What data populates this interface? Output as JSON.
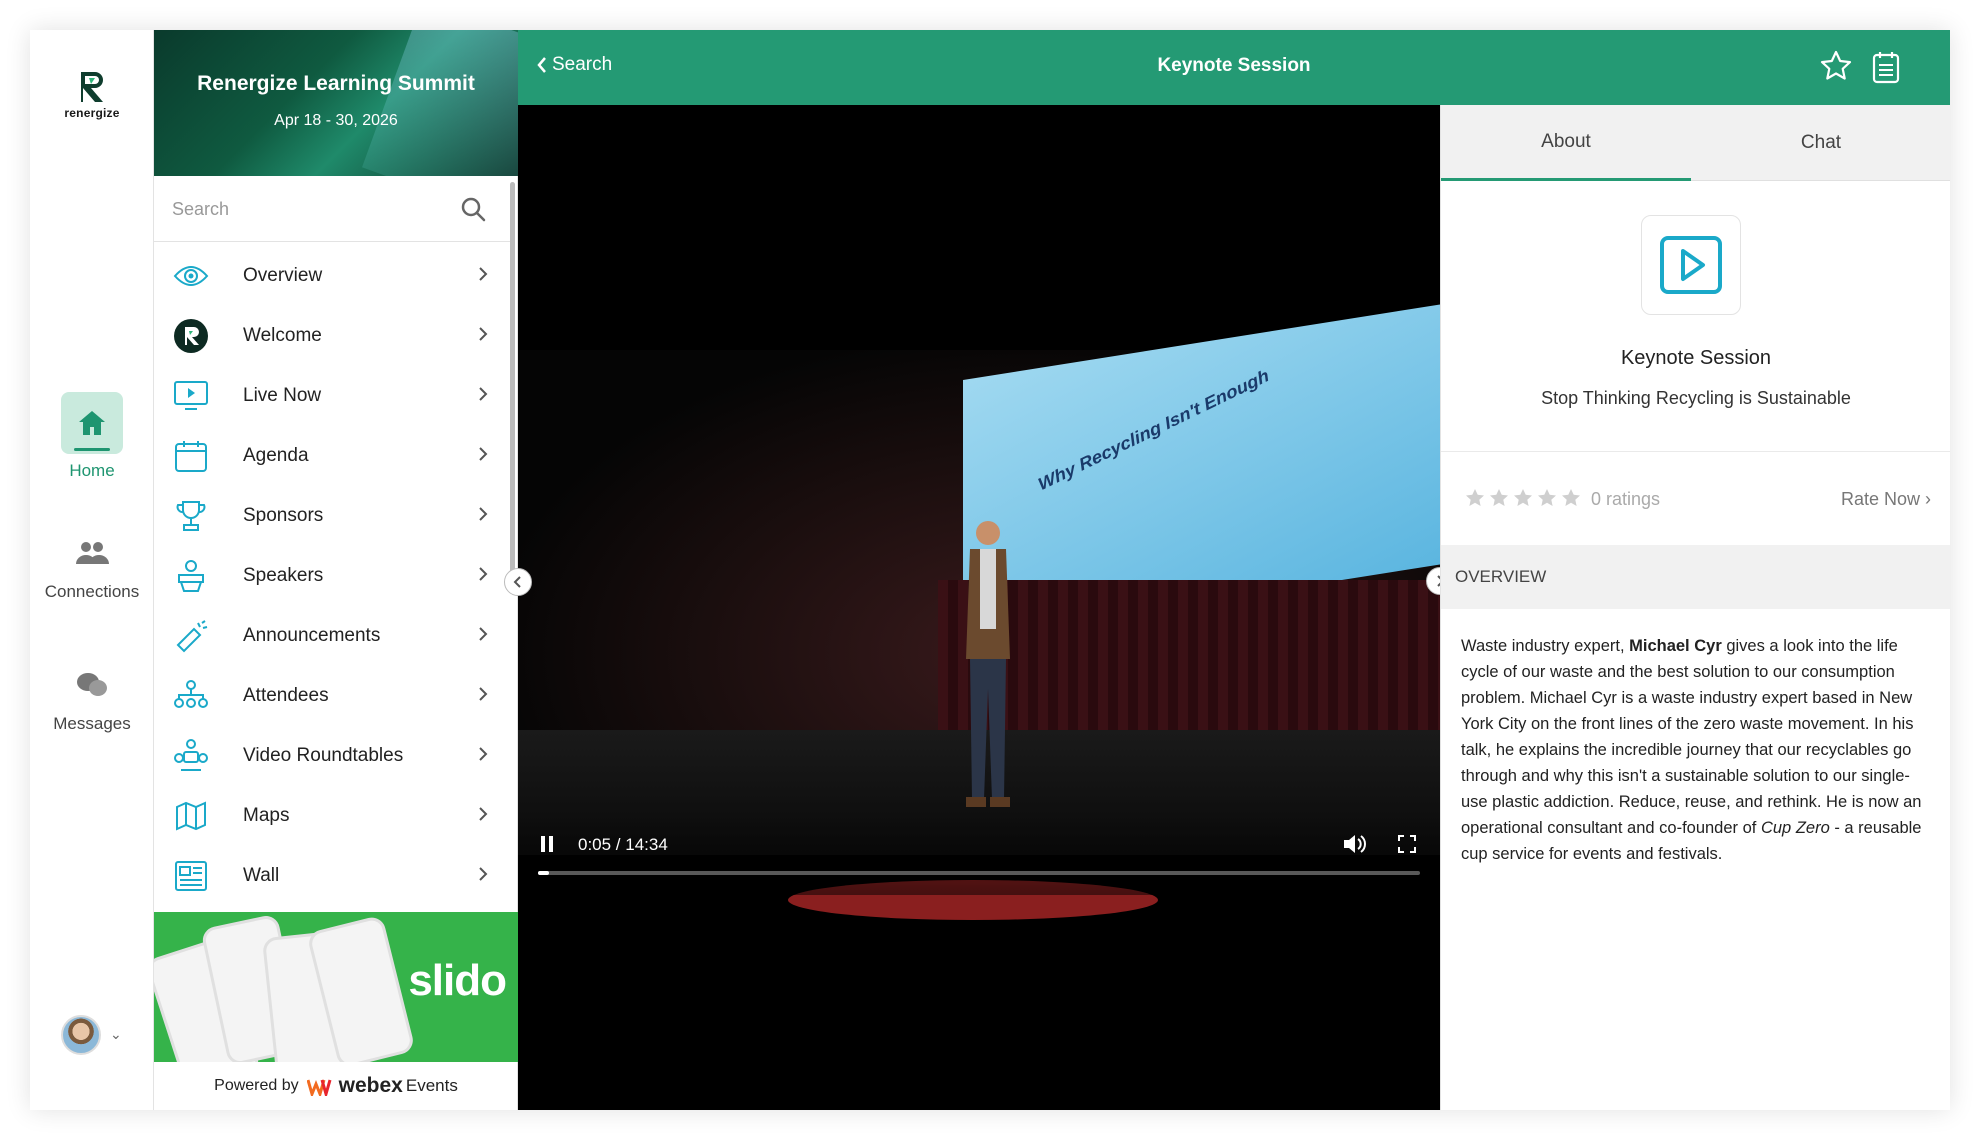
{
  "rail": {
    "brand": "renergize",
    "items": [
      {
        "label": "Home",
        "icon": "home-icon",
        "active": true
      },
      {
        "label": "Connections",
        "icon": "people-icon",
        "active": false
      },
      {
        "label": "Messages",
        "icon": "chat-bubbles-icon",
        "active": false
      }
    ]
  },
  "event": {
    "title": "Renergize Learning Summit",
    "dates": "Apr 18 - 30, 2026"
  },
  "search": {
    "placeholder": "Search"
  },
  "menu": [
    {
      "label": "Overview",
      "icon": "eye-icon"
    },
    {
      "label": "Welcome",
      "icon": "renergize-logo-icon"
    },
    {
      "label": "Live Now",
      "icon": "monitor-play-icon"
    },
    {
      "label": "Agenda",
      "icon": "calendar-icon"
    },
    {
      "label": "Sponsors",
      "icon": "trophy-icon"
    },
    {
      "label": "Speakers",
      "icon": "speaker-podium-icon"
    },
    {
      "label": "Announcements",
      "icon": "megaphone-icon"
    },
    {
      "label": "Attendees",
      "icon": "network-people-icon"
    },
    {
      "label": "Video Roundtables",
      "icon": "roundtable-icon"
    },
    {
      "label": "Maps",
      "icon": "map-icon"
    },
    {
      "label": "Wall",
      "icon": "wall-newspaper-icon"
    }
  ],
  "sponsor_banner": {
    "word": "slido"
  },
  "powered": {
    "prefix": "Powered by",
    "brand": "webex",
    "suffix": "Events"
  },
  "topbar": {
    "back_label": "Search",
    "title": "Keynote Session"
  },
  "video": {
    "screen_text": "Why Recycling Isn't Enough",
    "time": "0:05 / 14:34",
    "progress": 0.006
  },
  "panel": {
    "tabs": [
      {
        "label": "About",
        "active": true
      },
      {
        "label": "Chat",
        "active": false
      }
    ],
    "session_title": "Keynote Session",
    "session_subtitle": "Stop Thinking Recycling is Sustainable",
    "stars": 5,
    "ratings_label": "0 ratings",
    "rate_now": "Rate Now",
    "overview_heading": "OVERVIEW",
    "description": {
      "p1": "Waste industry expert, ",
      "bold": "Michael Cyr",
      "p2": " gives a look into the life cycle of our waste and the best solution to our consumption problem. Michael Cyr is a waste industry expert based in New York City on the front lines of the zero waste movement. In his talk, he explains the incredible journey that our recyclables go through and why this isn't a sustainable solution to our single-use plastic addiction. Reduce, reuse, and rethink. He is now an operational consultant and co-founder of ",
      "italic": "Cup Zero",
      "p3": " - a reusable cup service for events and festivals."
    }
  },
  "colors": {
    "accent": "#249a74",
    "home_bg": "#c9eadd",
    "icon_teal": "#1aa9c9",
    "slido_green": "#35b34a"
  }
}
